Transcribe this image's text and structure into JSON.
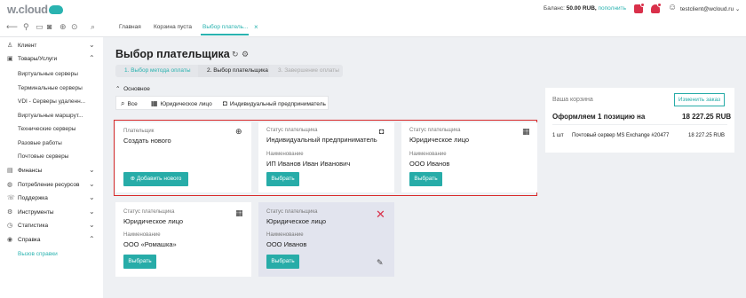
{
  "header": {
    "logo": "w.cloud",
    "balance_label": "Баланс:",
    "balance_value": "50.00 RUB,",
    "topup_link": "пополнить",
    "account": "testclient@wcloud.ru",
    "account_chevron": "⌄"
  },
  "tabs": [
    {
      "label": "Главная"
    },
    {
      "label": "Корзина пуста"
    },
    {
      "label": "Выбор платель..."
    }
  ],
  "sidebar": {
    "items": [
      {
        "label": "Клиент",
        "icon": "user-icon"
      },
      {
        "label": "Товары/Услуги",
        "icon": "box-icon"
      },
      {
        "label": "Финансы",
        "icon": "finance-icon"
      },
      {
        "label": "Потребление ресурсов",
        "icon": "globe-icon"
      },
      {
        "label": "Поддержка",
        "icon": "support-icon"
      },
      {
        "label": "Инструменты",
        "icon": "gear-icon"
      },
      {
        "label": "Статистика",
        "icon": "chart-icon"
      },
      {
        "label": "Справка",
        "icon": "help-icon"
      }
    ],
    "products_sub": [
      "Виртуальные серверы",
      "Терминальные серверы",
      "VDI - Серверы удаленн...",
      "Виртуальные маршрут...",
      "Технические серверы",
      "Разовые работы",
      "Почтовые серверы"
    ],
    "help_sub": [
      "Вызов справки"
    ]
  },
  "page": {
    "title": "Выбор плательщика",
    "steps": [
      "1. Выбор метода оплаты",
      "2. Выбор плательщика",
      "3. Завершение оплаты"
    ],
    "section": "Основное",
    "filters": [
      "Все",
      "Юридическое лицо",
      "Индивидуальный предприниматель"
    ]
  },
  "cards": [
    {
      "label1": "Плательщик",
      "value1": "Создать нового",
      "button": "Добавить нового"
    },
    {
      "label1": "Статус плательщика",
      "value1": "Индивидуальный предприниматель",
      "label2": "Наименование",
      "value2": "ИП Иванов Иван Иванович",
      "button": "Выбрать"
    },
    {
      "label1": "Статус плательщика",
      "value1": "Юридическое лицо",
      "label2": "Наименование",
      "value2": "ООО Иванов",
      "button": "Выбрать"
    },
    {
      "label1": "Статус плательщика",
      "value1": "Юридическое лицо",
      "label2": "Наименование",
      "value2": "ООО «Ромашка»",
      "button": "Выбрать"
    },
    {
      "label1": "Статус плательщика",
      "value1": "Юридическое лицо",
      "label2": "Наименование",
      "value2": "ООО Иванов",
      "button": "Выбрать"
    }
  ],
  "cart": {
    "title": "Ваша корзина",
    "edit_button": "Изменить заказ",
    "summary": "Оформляем 1 позицию на",
    "total": "18 227.25 RUB",
    "qty": "1 шт",
    "item_name": "Почтовый сервер MS Exchange #20477",
    "item_price": "18 227.25 RUB"
  },
  "colors": {
    "accent": "#27aca8",
    "danger": "#d92b2b"
  }
}
